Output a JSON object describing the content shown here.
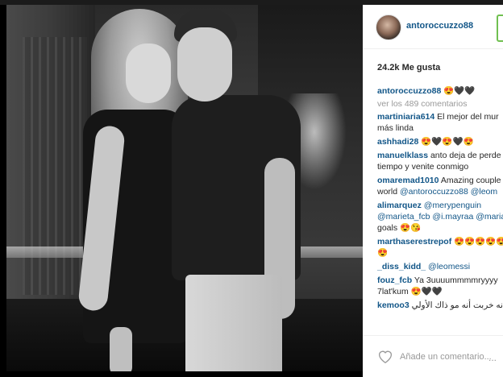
{
  "header": {
    "username": "antoroccuzzo88"
  },
  "likes": "24.2k Me gusta",
  "caption": {
    "user": "antoroccuzzo88",
    "text": "😍🖤🖤"
  },
  "view_all": "ver los 489 comentarios",
  "comments": [
    {
      "user": "martiniaria614",
      "text": "El mejor del mur",
      "text2": "más linda"
    },
    {
      "user": "ashhadi28",
      "text": "😍🖤😍🖤😍"
    },
    {
      "user": "manuelklass",
      "text": "anto deja de perde",
      "text2": "tiempo y venite conmigo"
    },
    {
      "user": "omaremad1010",
      "text": "Amazing couple",
      "text2a": "world ",
      "mention2": "@antoroccuzzo88 @leom"
    },
    {
      "user": "alimarquez",
      "mention": "@merypenguin",
      "mention_b": "@marieta_fcb @i.mayraa @maria",
      "text3": "goals 😍😘"
    },
    {
      "user": "marthaserestrepof",
      "text": "😍😍😍😍😍😍",
      "text2": "😍"
    },
    {
      "user": "_diss_kidd_",
      "mention": "@leomessi"
    },
    {
      "user": "fouz_fcb",
      "text": "Ya 3uuuummmmryyyy",
      "text2": "7lat'kum 😍🖤🖤"
    },
    {
      "user": "kemoo3",
      "text": "إنه خربت أنه مو ذاك الأولي"
    }
  ],
  "footer": {
    "placeholder": "Añade un comentario...",
    "more": "..."
  },
  "colors": {
    "link": "#125688",
    "text": "#262626",
    "muted": "#999999"
  }
}
